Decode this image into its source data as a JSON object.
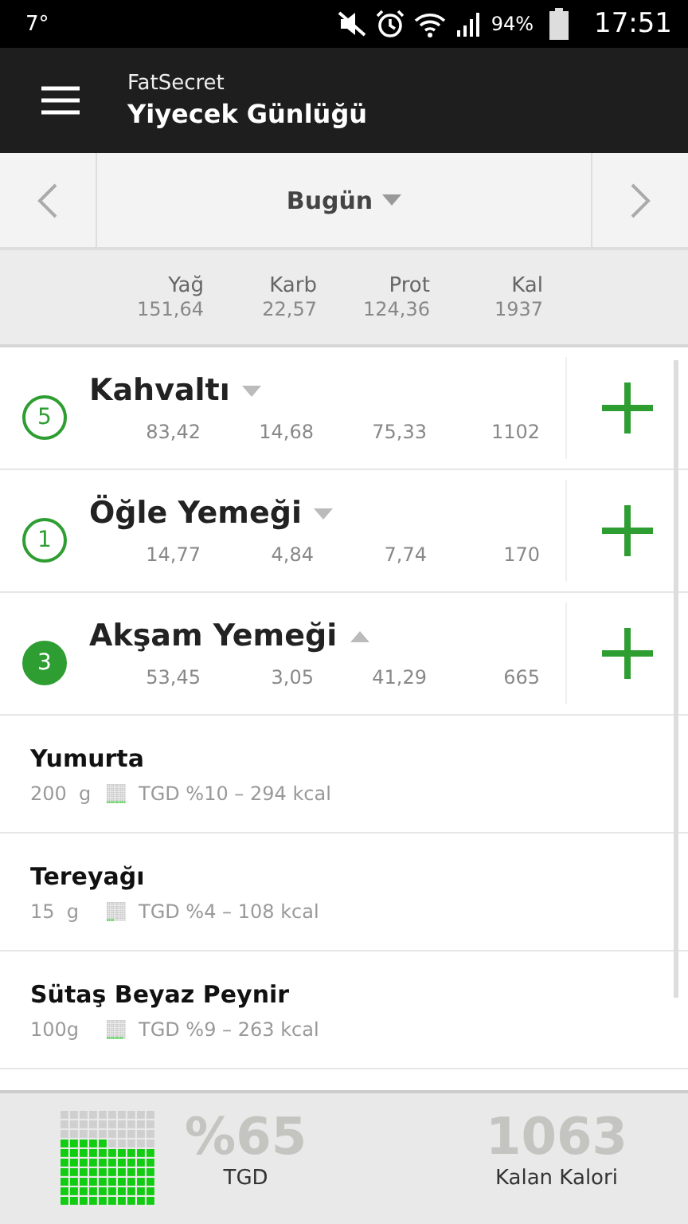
{
  "status_bar": {
    "temperature": "7°",
    "battery": "94%",
    "time": "17:51"
  },
  "app_bar": {
    "app_name": "FatSecret",
    "title": "Yiyecek Günlüğü"
  },
  "date_nav": {
    "label": "Bugün"
  },
  "totals": [
    {
      "label": "Yağ",
      "value": "151,64"
    },
    {
      "label": "Karb",
      "value": "22,57"
    },
    {
      "label": "Prot",
      "value": "124,36"
    },
    {
      "label": "Kal",
      "value": "1937"
    }
  ],
  "meals": [
    {
      "count": "5",
      "name": "Kahvaltı",
      "expanded": false,
      "values": [
        "83,42",
        "14,68",
        "75,33",
        "1102"
      ]
    },
    {
      "count": "1",
      "name": "Öğle Yemeği",
      "expanded": false,
      "values": [
        "14,77",
        "4,84",
        "7,74",
        "170"
      ]
    },
    {
      "count": "3",
      "name": "Akşam Yemeği",
      "expanded": true,
      "values": [
        "53,45",
        "3,05",
        "41,29",
        "665"
      ]
    }
  ],
  "foods": [
    {
      "name": "Yumurta",
      "amount": "200  g",
      "tgd": "TGD %10 – 294 kcal"
    },
    {
      "name": "Tereyağı",
      "amount": "15  g",
      "tgd": "TGD %4 – 108 kcal"
    },
    {
      "name": "Sütaş Beyaz Peynir",
      "amount": "100g",
      "tgd": "TGD %9 – 263 kcal"
    }
  ],
  "footer": {
    "tgd_value": "%65",
    "tgd_label": "TGD",
    "remaining": "1063",
    "remaining_label": "Kalan Kalori"
  }
}
